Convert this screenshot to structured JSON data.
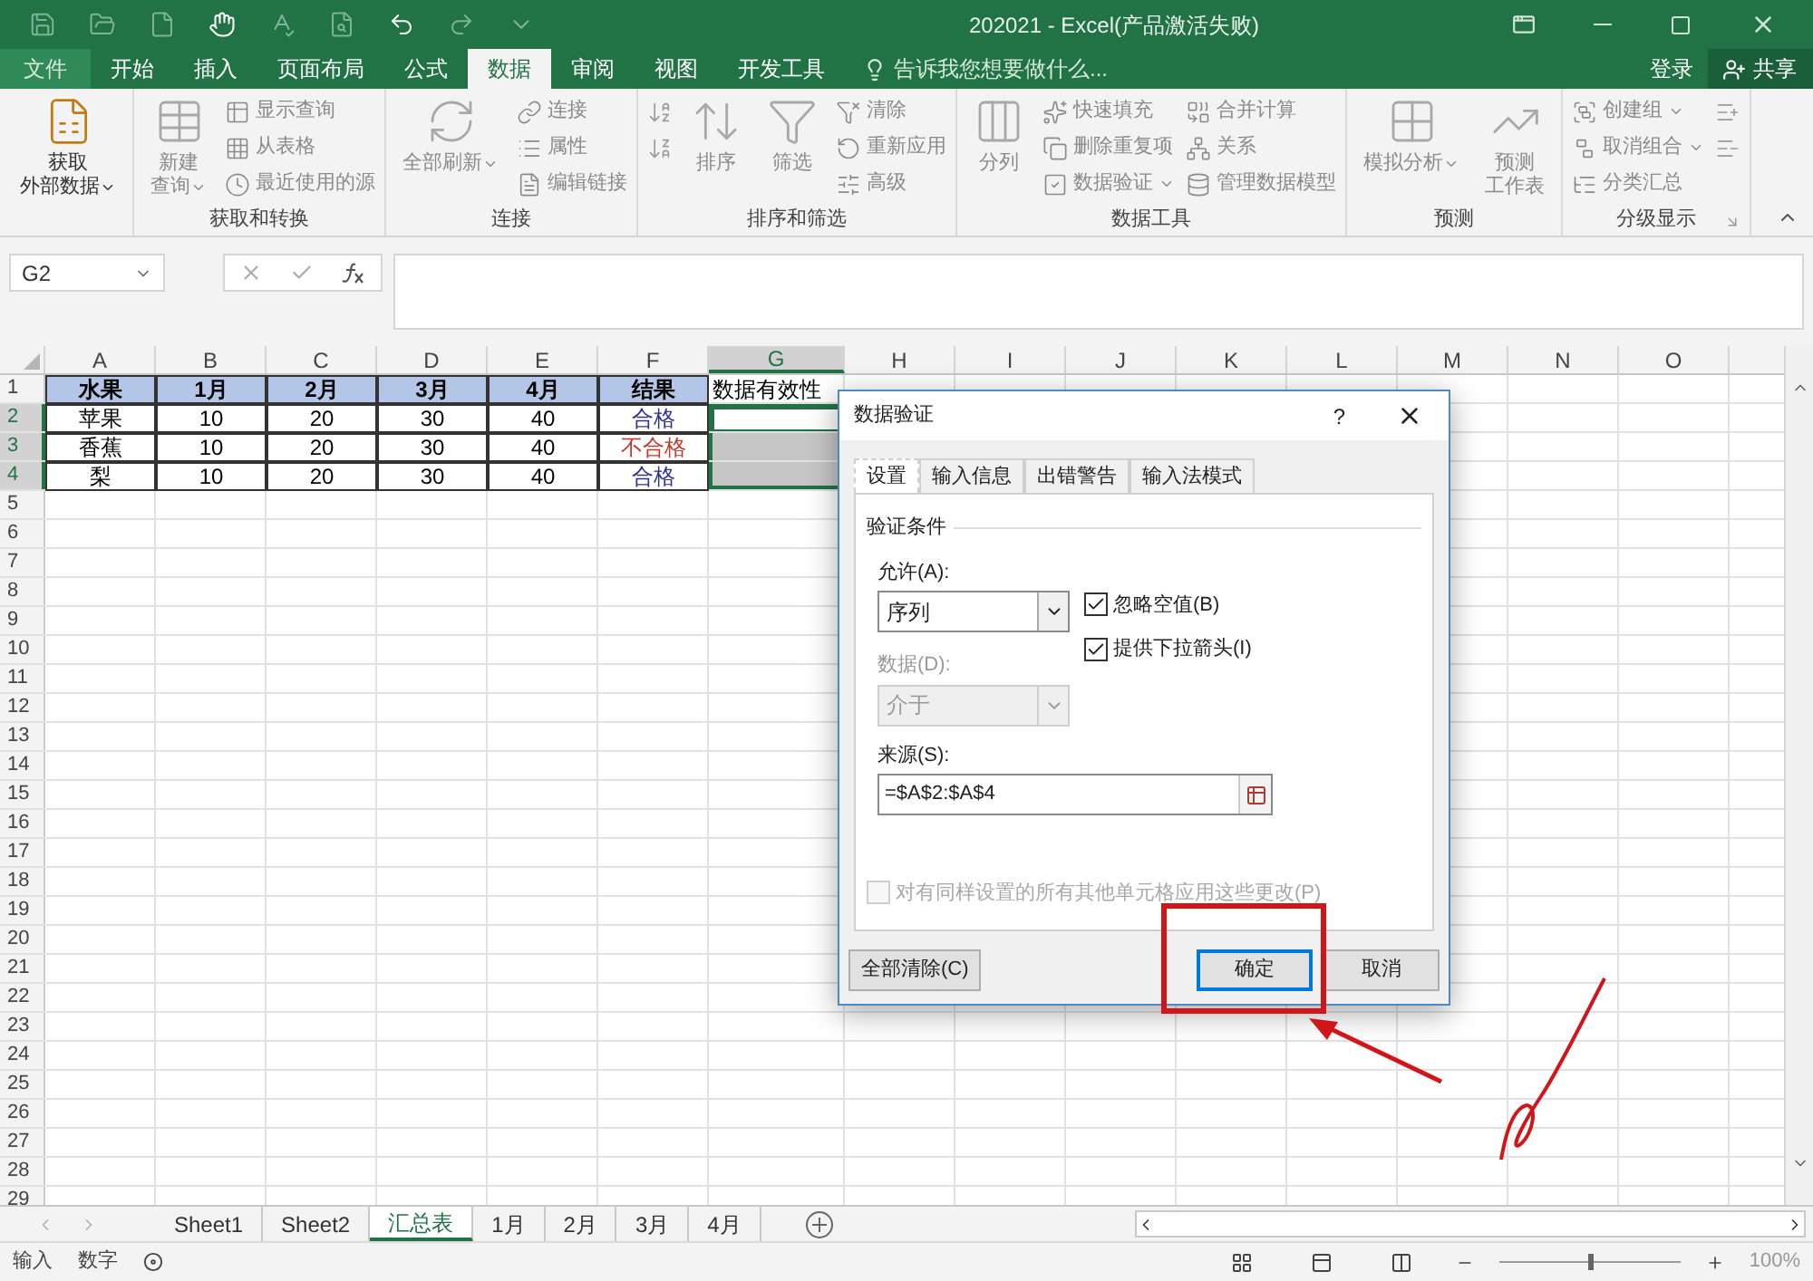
{
  "window": {
    "title": "202021 - Excel(产品激活失败)"
  },
  "tabs": [
    {
      "label": "文件",
      "kind": "file",
      "selected": false
    },
    {
      "label": "开始",
      "kind": "tab",
      "selected": false
    },
    {
      "label": "插入",
      "kind": "tab",
      "selected": false
    },
    {
      "label": "页面布局",
      "kind": "tab",
      "selected": false
    },
    {
      "label": "公式",
      "kind": "tab",
      "selected": false
    },
    {
      "label": "数据",
      "kind": "tab",
      "selected": true
    },
    {
      "label": "审阅",
      "kind": "tab",
      "selected": false
    },
    {
      "label": "视图",
      "kind": "tab",
      "selected": false
    },
    {
      "label": "开发工具",
      "kind": "tab",
      "selected": false
    }
  ],
  "tell_me": {
    "placeholder": "告诉我您想要做什么..."
  },
  "sign_in": "登录",
  "share": "共享",
  "ribbon": [
    {
      "items": [
        {
          "kind": "large",
          "lines": [
            "获取",
            "外部数据"
          ],
          "dropdown": true,
          "disabled": false
        }
      ]
    },
    {
      "label": "获取和转换",
      "items": [
        {
          "kind": "large",
          "lines": [
            "新建",
            "查询"
          ],
          "dropdown": true,
          "disabled": true
        },
        {
          "kind": "stack",
          "items": [
            {
              "kind": "small",
              "label": "显示查询",
              "dropdown": false,
              "disabled": true
            },
            {
              "kind": "small",
              "label": "从表格",
              "dropdown": false,
              "disabled": true
            },
            {
              "kind": "small",
              "label": "最近使用的源",
              "dropdown": false,
              "disabled": true
            }
          ]
        }
      ]
    },
    {
      "label": "连接",
      "items": [
        {
          "kind": "large",
          "lines": [
            "全部刷新"
          ],
          "dropdown": true,
          "disabled": true
        },
        {
          "kind": "stack",
          "items": [
            {
              "kind": "small",
              "label": "连接",
              "dropdown": false,
              "disabled": true
            },
            {
              "kind": "small",
              "label": "属性",
              "dropdown": false,
              "disabled": true
            },
            {
              "kind": "small",
              "label": "编辑链接",
              "dropdown": false,
              "disabled": true
            }
          ]
        }
      ]
    },
    {
      "label": "排序和筛选",
      "items": [
        {
          "kind": "stack",
          "items": [
            {
              "kind": "icon",
              "dropdown": false,
              "disabled": true
            },
            {
              "kind": "icon",
              "dropdown": false,
              "disabled": true
            }
          ]
        },
        {
          "kind": "large",
          "lines": [
            "排序"
          ],
          "dropdown": false,
          "disabled": true
        },
        {
          "kind": "large",
          "lines": [
            "筛选"
          ],
          "dropdown": false,
          "disabled": true
        },
        {
          "kind": "stack",
          "items": [
            {
              "kind": "small",
              "label": "清除",
              "dropdown": false,
              "disabled": true
            },
            {
              "kind": "small",
              "label": "重新应用",
              "dropdown": false,
              "disabled": true
            },
            {
              "kind": "small",
              "label": "高级",
              "dropdown": false,
              "disabled": true
            }
          ]
        }
      ]
    },
    {
      "label": "数据工具",
      "items": [
        {
          "kind": "large",
          "lines": [
            "分列"
          ],
          "dropdown": false,
          "disabled": true
        },
        {
          "kind": "stack",
          "items": [
            {
              "kind": "small",
              "label": "快速填充",
              "dropdown": false,
              "disabled": true
            },
            {
              "kind": "small",
              "label": "删除重复项",
              "dropdown": false,
              "disabled": true
            },
            {
              "kind": "small",
              "label": "数据验证",
              "dropdown": true,
              "disabled": true
            }
          ]
        },
        {
          "kind": "stack",
          "items": [
            {
              "kind": "small",
              "label": "合并计算",
              "dropdown": false,
              "disabled": true
            },
            {
              "kind": "small",
              "label": "关系",
              "dropdown": false,
              "disabled": true
            },
            {
              "kind": "small",
              "label": "管理数据模型",
              "dropdown": false,
              "disabled": true
            }
          ]
        }
      ]
    },
    {
      "label": "预测",
      "items": [
        {
          "kind": "large",
          "lines": [
            "模拟分析"
          ],
          "dropdown": true,
          "disabled": true
        },
        {
          "kind": "large",
          "lines": [
            "预测",
            "工作表"
          ],
          "dropdown": false,
          "disabled": true
        }
      ]
    },
    {
      "label": "分级显示",
      "launcher": true,
      "items": [
        {
          "kind": "stack",
          "items": [
            {
              "kind": "small",
              "label": "创建组",
              "dropdown": true,
              "disabled": true
            },
            {
              "kind": "small",
              "label": "取消组合",
              "dropdown": true,
              "disabled": true
            },
            {
              "kind": "small",
              "label": "分类汇总",
              "dropdown": false,
              "disabled": true
            }
          ]
        },
        {
          "kind": "stack",
          "items": [
            {
              "kind": "icon",
              "dropdown": false,
              "disabled": true
            },
            {
              "kind": "icon",
              "dropdown": false,
              "disabled": true
            }
          ]
        }
      ]
    }
  ],
  "name_box": "G2",
  "columns": [
    {
      "label": "A",
      "selected": false
    },
    {
      "label": "B",
      "selected": false
    },
    {
      "label": "C",
      "selected": false
    },
    {
      "label": "D",
      "selected": false
    },
    {
      "label": "E",
      "selected": false
    },
    {
      "label": "F",
      "selected": false
    },
    {
      "label": "G",
      "selected": true
    },
    {
      "label": "H",
      "selected": false
    },
    {
      "label": "I",
      "selected": false
    },
    {
      "label": "J",
      "selected": false
    },
    {
      "label": "K",
      "selected": false
    },
    {
      "label": "L",
      "selected": false
    },
    {
      "label": "M",
      "selected": false
    },
    {
      "label": "N",
      "selected": false
    },
    {
      "label": "O",
      "selected": false
    }
  ],
  "rows": [
    {
      "number": "1",
      "selected": false,
      "cells": [
        {
          "text": "水果",
          "kind": "header",
          "selected": false,
          "active": false
        },
        {
          "text": "1月",
          "kind": "header",
          "selected": false,
          "active": false
        },
        {
          "text": "2月",
          "kind": "header",
          "selected": false,
          "active": false
        },
        {
          "text": "3月",
          "kind": "header",
          "selected": false,
          "active": false
        },
        {
          "text": "4月",
          "kind": "header",
          "selected": false,
          "active": false
        },
        {
          "text": "结果",
          "kind": "header",
          "selected": false,
          "active": false
        },
        {
          "text": "数据有效性",
          "kind": "plain",
          "selected": false,
          "active": false
        }
      ]
    },
    {
      "number": "2",
      "selected": true,
      "cells": [
        {
          "text": "苹果",
          "kind": "value",
          "selected": false,
          "active": false
        },
        {
          "text": "10",
          "kind": "value",
          "selected": false,
          "active": false
        },
        {
          "text": "20",
          "kind": "value",
          "selected": false,
          "active": false
        },
        {
          "text": "30",
          "kind": "value",
          "selected": false,
          "active": false
        },
        {
          "text": "40",
          "kind": "value",
          "selected": false,
          "active": false
        },
        {
          "text": "合格",
          "kind": "value",
          "color": "#2e3192",
          "selected": false,
          "active": false
        },
        {
          "kind": "plain",
          "selected": true,
          "active": true
        }
      ]
    },
    {
      "number": "3",
      "selected": true,
      "cells": [
        {
          "text": "香蕉",
          "kind": "value",
          "selected": false,
          "active": false
        },
        {
          "text": "10",
          "kind": "value",
          "selected": false,
          "active": false
        },
        {
          "text": "20",
          "kind": "value",
          "selected": false,
          "active": false
        },
        {
          "text": "30",
          "kind": "value",
          "selected": false,
          "active": false
        },
        {
          "text": "40",
          "kind": "value",
          "selected": false,
          "active": false
        },
        {
          "text": "不合格",
          "kind": "value",
          "color": "#c0392b",
          "selected": false,
          "active": false
        },
        {
          "kind": "plain",
          "selected": true,
          "active": false
        }
      ]
    },
    {
      "number": "4",
      "selected": true,
      "cells": [
        {
          "text": "梨",
          "kind": "value",
          "selected": false,
          "active": false
        },
        {
          "text": "10",
          "kind": "value",
          "selected": false,
          "active": false
        },
        {
          "text": "20",
          "kind": "value",
          "selected": false,
          "active": false
        },
        {
          "text": "30",
          "kind": "value",
          "selected": false,
          "active": false
        },
        {
          "text": "40",
          "kind": "value",
          "selected": false,
          "active": false
        },
        {
          "text": "合格",
          "kind": "value",
          "color": "#2e3192",
          "selected": false,
          "active": false
        },
        {
          "kind": "plain",
          "selected": true,
          "active": false
        }
      ]
    },
    {
      "number": "5",
      "selected": false
    },
    {
      "number": "6",
      "selected": false
    },
    {
      "number": "7",
      "selected": false
    },
    {
      "number": "8",
      "selected": false
    },
    {
      "number": "9",
      "selected": false
    },
    {
      "number": "10",
      "selected": false
    },
    {
      "number": "11",
      "selected": false
    },
    {
      "number": "12",
      "selected": false
    },
    {
      "number": "13",
      "selected": false
    },
    {
      "number": "14",
      "selected": false
    },
    {
      "number": "15",
      "selected": false
    },
    {
      "number": "16",
      "selected": false
    },
    {
      "number": "17",
      "selected": false
    },
    {
      "number": "18",
      "selected": false
    },
    {
      "number": "19",
      "selected": false
    },
    {
      "number": "20",
      "selected": false
    },
    {
      "number": "21",
      "selected": false
    },
    {
      "number": "22",
      "selected": false
    },
    {
      "number": "23",
      "selected": false
    },
    {
      "number": "24",
      "selected": false
    },
    {
      "number": "25",
      "selected": false
    },
    {
      "number": "26",
      "selected": false
    },
    {
      "number": "27",
      "selected": false
    },
    {
      "number": "28",
      "selected": false
    },
    {
      "number": "29",
      "selected": false
    }
  ],
  "dialog": {
    "title": "数据验证",
    "help": "?",
    "tabs": [
      {
        "label": "设置",
        "selected": true
      },
      {
        "label": "输入信息",
        "selected": false
      },
      {
        "label": "出错警告",
        "selected": false
      },
      {
        "label": "输入法模式",
        "selected": false
      }
    ],
    "section": "验证条件",
    "allow": {
      "label": "允许(A):",
      "value": "序列",
      "disabled": false
    },
    "data": {
      "label": "数据(D):",
      "value": "介于",
      "disabled": true
    },
    "options": [
      {
        "label": "忽略空值(B)",
        "checked": true,
        "disabled": false
      },
      {
        "label": "提供下拉箭头(I)",
        "checked": true,
        "disabled": false
      }
    ],
    "source": {
      "label": "来源(S):",
      "value": "=$A$2:$A$4"
    },
    "apply_all": {
      "label": "对有同样设置的所有其他单元格应用这些更改(P)",
      "checked": false,
      "disabled": true
    },
    "buttons": [
      {
        "label": "全部清除(C)",
        "default": false
      },
      {
        "label": "确定",
        "default": true
      },
      {
        "label": "取消",
        "default": false
      }
    ]
  },
  "sheets": [
    {
      "label": "Sheet1",
      "selected": false
    },
    {
      "label": "Sheet2",
      "selected": false
    },
    {
      "label": "汇总表",
      "selected": true
    },
    {
      "label": "1月",
      "selected": false
    },
    {
      "label": "2月",
      "selected": false
    },
    {
      "label": "3月",
      "selected": false
    },
    {
      "label": "4月",
      "selected": false
    }
  ],
  "status": [
    "输入",
    "数字"
  ],
  "zoom": {
    "level": 0.5,
    "reading": "100%"
  }
}
